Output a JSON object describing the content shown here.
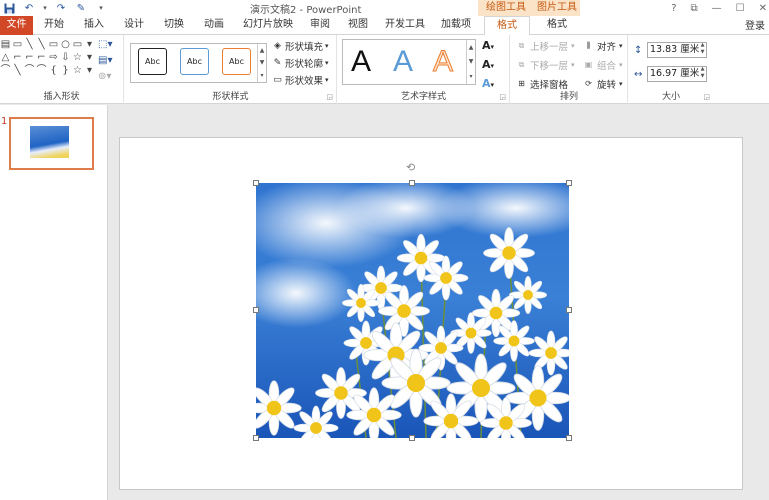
{
  "title_bar": {
    "doc_title": "演示文稿2 - PowerPoint",
    "qat_icons": [
      "save-icon",
      "undo-icon",
      "redo-icon",
      "pen-icon",
      "customize-icon"
    ],
    "context_group_drawing": "绘图工具",
    "context_group_picture": "图片工具",
    "controls": [
      "?",
      "⧉",
      "—",
      "☐",
      "✕"
    ]
  },
  "tabs": {
    "file": "文件",
    "home": "开始",
    "insert": "插入",
    "design": "设计",
    "transitions": "切换",
    "animations": "动画",
    "slideshow": "幻灯片放映",
    "review": "审阅",
    "view": "视图",
    "developer": "开发工具",
    "addins": "加载项",
    "format_drawing": "格式",
    "format_picture": "格式",
    "login": "登录"
  },
  "ribbon": {
    "insert_shapes": {
      "label": "插入形状",
      "shapes": [
        "▤",
        "▭",
        "╲",
        "╲",
        "▭",
        "○",
        "▭",
        "▾",
        "△",
        "⌐",
        "⌐",
        "⌐",
        "⇨",
        "⇩",
        "☆",
        "▾",
        "⌒",
        "╲",
        "⌒",
        "⌒",
        "{",
        "}",
        "☆",
        "▾"
      ]
    },
    "shape_styles": {
      "label": "形状样式",
      "presets": [
        "Abc",
        "Abc",
        "Abc"
      ],
      "preset_colors": [
        "#222222",
        "#5b9bd5",
        "#ed7d31"
      ],
      "fill": "形状填充",
      "outline": "形状轮廓",
      "effects": "形状效果"
    },
    "wordart_styles": {
      "label": "艺术字样式",
      "letters": [
        "A",
        "A",
        "A"
      ]
    },
    "arrange": {
      "label": "排列",
      "bring_forward": "上移一层",
      "send_backward": "下移一层",
      "selection_pane": "选择窗格",
      "align": "对齐",
      "group": "组合",
      "rotate": "旋转"
    },
    "size": {
      "label": "大小",
      "height": "13.83 厘米",
      "width": "16.97 厘米"
    }
  },
  "slides_pane": {
    "slide_number": "1"
  },
  "colors": {
    "file_tab": "#d24726",
    "context_accent": "#c65911",
    "context_bg": "#fbe3c8",
    "thumb_border": "#e07b4a"
  }
}
